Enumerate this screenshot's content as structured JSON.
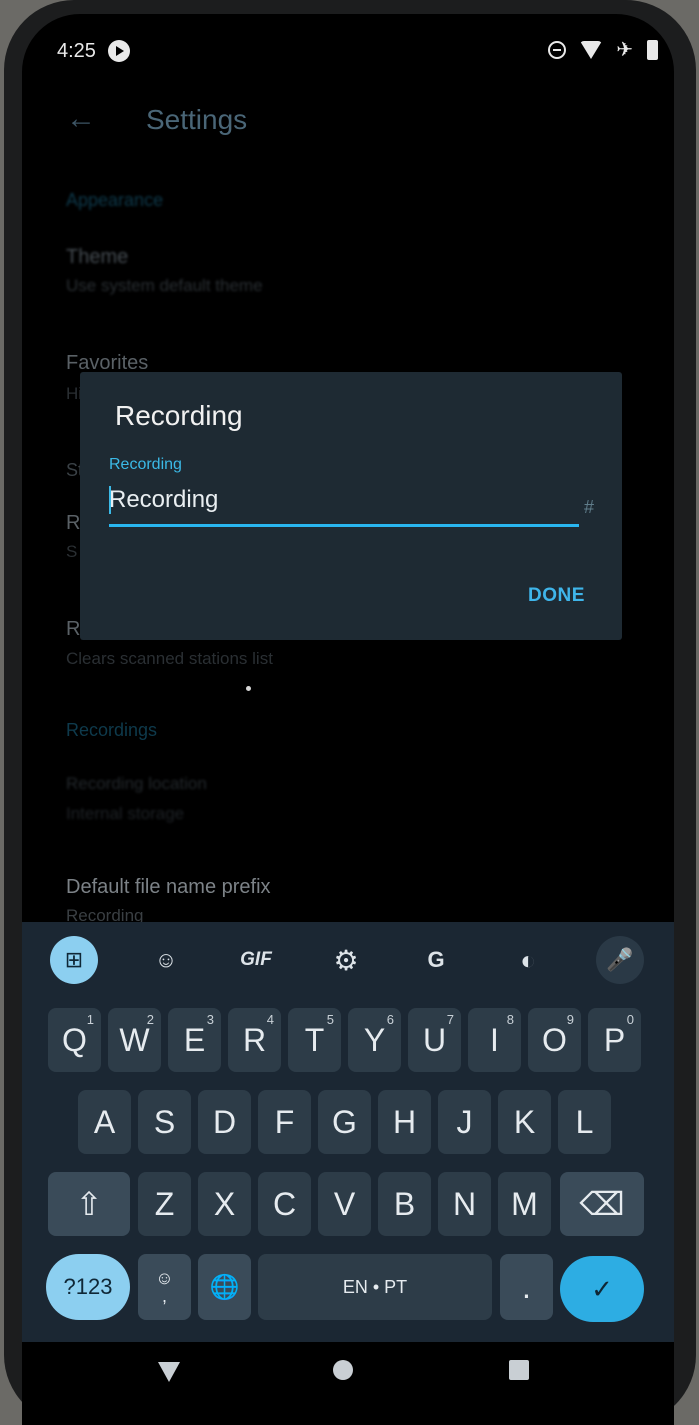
{
  "status_bar": {
    "time": "4:25"
  },
  "app_bar": {
    "back": "←",
    "title": "Settings"
  },
  "settings": {
    "appearance_header": "Appearance",
    "theme_title": "Theme",
    "theme_sub": "Use system default theme",
    "favorites_title": "Favorites",
    "favorites_sub": "Hide",
    "stations_header": "Stations",
    "r1_title": "R",
    "r1_sub": "S",
    "r2_title": "R",
    "r2_sub": "Clears scanned stations list",
    "recordings_header": "Recordings",
    "rec_sub1": "Recording location",
    "rec_sub2": "Internal storage",
    "prefix_title": "Default file name prefix",
    "prefix_sub": "Recording"
  },
  "dialog": {
    "title": "Recording",
    "label": "Recording",
    "value": "Recording",
    "counter": "#",
    "done": "DONE"
  },
  "keyboard": {
    "toolbar": [
      {
        "name": "apps-grid-icon",
        "glyph": "⊞"
      },
      {
        "name": "sticker-icon",
        "glyph": "☺"
      },
      {
        "name": "gif-button",
        "glyph": "GIF"
      },
      {
        "name": "settings-gear-icon",
        "glyph": "⚙"
      },
      {
        "name": "translate-icon",
        "glyph": "G"
      },
      {
        "name": "palette-icon",
        "glyph": "◐"
      },
      {
        "name": "mic-icon",
        "glyph": "🎤"
      }
    ],
    "row1": [
      {
        "k": "Q",
        "s": "1"
      },
      {
        "k": "W",
        "s": "2"
      },
      {
        "k": "E",
        "s": "3"
      },
      {
        "k": "R",
        "s": "4"
      },
      {
        "k": "T",
        "s": "5"
      },
      {
        "k": "Y",
        "s": "6"
      },
      {
        "k": "U",
        "s": "7"
      },
      {
        "k": "I",
        "s": "8"
      },
      {
        "k": "O",
        "s": "9"
      },
      {
        "k": "P",
        "s": "0"
      }
    ],
    "row2": [
      "A",
      "S",
      "D",
      "F",
      "G",
      "H",
      "J",
      "K",
      "L"
    ],
    "row3": [
      "Z",
      "X",
      "C",
      "V",
      "B",
      "N",
      "M"
    ],
    "shift": "⇧",
    "backspace": "⌫",
    "symbols": "?123",
    "emoji": "☺",
    "comma": ",",
    "globe": "🌐",
    "space": "EN • PT",
    "period": ".",
    "enter": "✓"
  }
}
